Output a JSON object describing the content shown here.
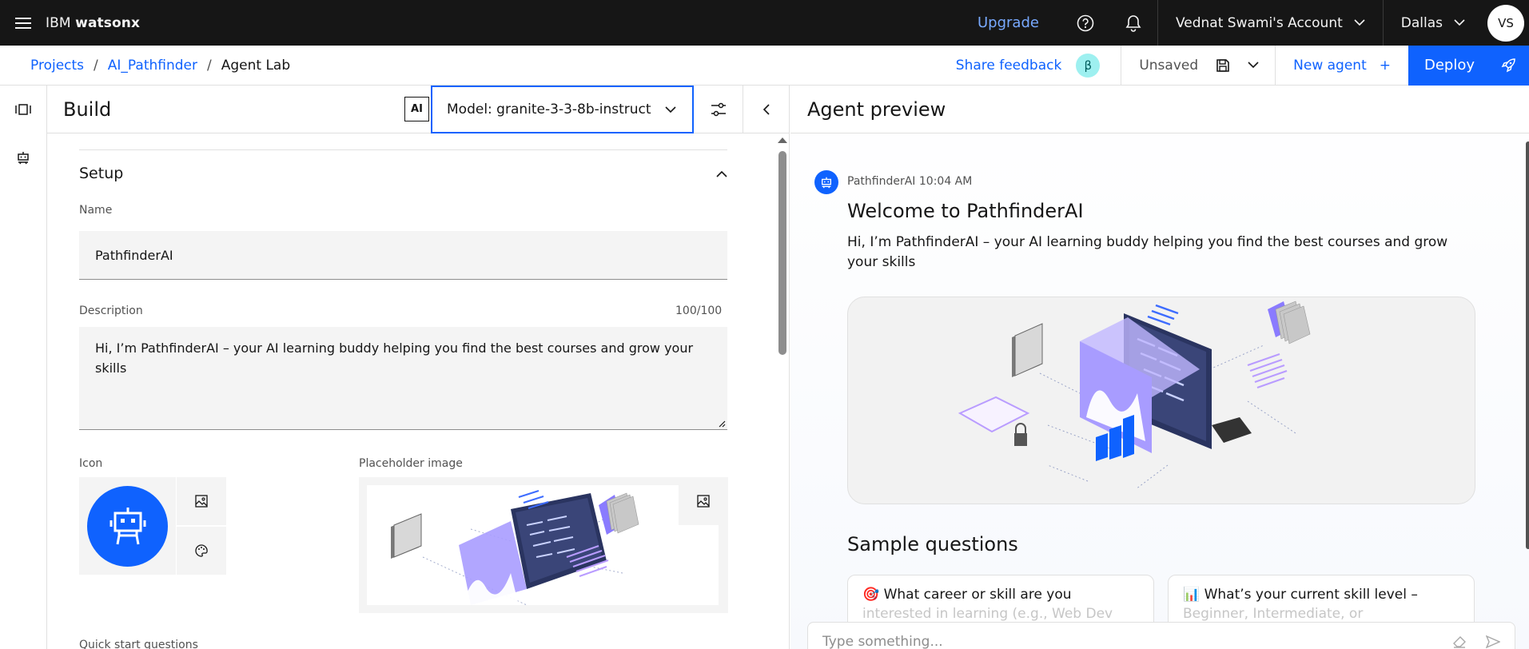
{
  "topbar": {
    "brand_prefix": "IBM",
    "brand_product": "watsonx",
    "upgrade": "Upgrade",
    "account": "Vednat Swami's Account",
    "region": "Dallas",
    "avatar_initials": "VS"
  },
  "subbar": {
    "breadcrumb": [
      "Projects",
      "AI_Pathfinder",
      "Agent Lab"
    ],
    "breadcrumb_sep": "/",
    "share_feedback": "Share feedback",
    "beta": "β",
    "status": "Unsaved",
    "new_agent": "New agent",
    "new_agent_plus": "+",
    "deploy": "Deploy"
  },
  "build": {
    "title": "Build",
    "ai_badge": "AI",
    "model_label": "Model: granite-3-3-8b-instruct",
    "setup": {
      "heading": "Setup",
      "name_label": "Name",
      "name_value": "PathfinderAI",
      "description_label": "Description",
      "description_counter": "100/100",
      "description_value": "Hi, I’m PathfinderAI – your AI learning buddy helping you find the best courses and grow your skills",
      "icon_label": "Icon",
      "placeholder_label": "Placeholder image",
      "quick_start_label": "Quick start questions"
    }
  },
  "preview": {
    "title": "Agent preview",
    "message": {
      "sender": "PathfinderAI",
      "time": "10:04 AM",
      "title": "Welcome to PathfinderAI",
      "body": "Hi, I’m PathfinderAI – your AI learning buddy helping you find the best courses and grow your skills"
    },
    "sample_title": "Sample questions",
    "samples": [
      {
        "emoji": "🎯",
        "line1": "What career or skill are you",
        "line2": "interested in learning (e.g., Web Dev"
      },
      {
        "emoji": "📊",
        "line1": "What’s your current skill level –",
        "line2": "Beginner, Intermediate, or"
      }
    ],
    "input_placeholder": "Type something..."
  },
  "colors": {
    "accent": "#0f62fe",
    "topbar_bg": "#161616",
    "upgrade_link": "#78a9ff",
    "beta_bg": "#9ef0f0",
    "illustration_purple": "#8a7bff",
    "illustration_navy": "#2a3460"
  },
  "icons": [
    "hamburger-icon",
    "help-icon",
    "notification-icon",
    "chevron-down-icon",
    "save-icon",
    "send-icon",
    "filter-icon",
    "chevron-left-icon",
    "agent-rail-icon",
    "robot-icon",
    "image-icon",
    "palette-icon",
    "eraser-icon",
    "target-emoji",
    "chart-emoji"
  ]
}
